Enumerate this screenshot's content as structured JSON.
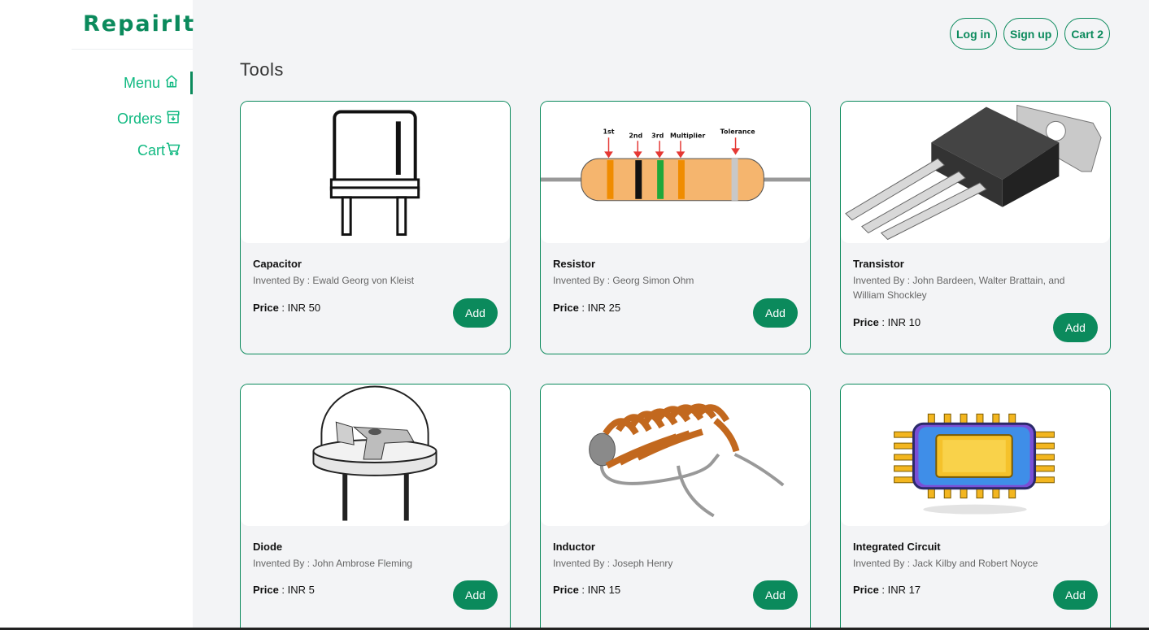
{
  "brand": "RepairIt",
  "nav": [
    {
      "label": "Menu",
      "icon": "home-icon"
    },
    {
      "label": "Orders",
      "icon": "archive-icon"
    },
    {
      "label": "Cart",
      "icon": "cart-icon"
    }
  ],
  "header": {
    "login": "Log in",
    "signup": "Sign up",
    "cart": "Cart 2"
  },
  "section_title": "Tools",
  "products": [
    {
      "name": "Capacitor",
      "inventor": "Invented By : Ewald Georg von Kleist",
      "price_label": "Price",
      "price_value": " : INR 50",
      "add": "Add"
    },
    {
      "name": "Resistor",
      "inventor": "Invented By : Georg Simon Ohm",
      "price_label": "Price",
      "price_value": " : INR 25",
      "add": "Add"
    },
    {
      "name": "Transistor",
      "inventor": "Invented By : John Bardeen, Walter Brattain, and William Shockley",
      "price_label": "Price",
      "price_value": " : INR 10",
      "add": "Add"
    },
    {
      "name": "Diode",
      "inventor": "Invented By : John Ambrose Fleming",
      "price_label": "Price",
      "price_value": " : INR 5",
      "add": "Add"
    },
    {
      "name": "Inductor",
      "inventor": "Invented By : Joseph Henry",
      "price_label": "Price",
      "price_value": " : INR 15",
      "add": "Add"
    },
    {
      "name": "Integrated Circuit",
      "inventor": "Invented By : Jack Kilby and Robert Noyce",
      "price_label": "Price",
      "price_value": " : INR 17",
      "add": "Add"
    }
  ],
  "resistor_labels": {
    "first": "1st",
    "second": "2nd",
    "third": "3rd",
    "multiplier": "Multiplier",
    "tolerance": "Tolerance"
  },
  "colors": {
    "accent": "#0b8a5c",
    "nav_text": "#10b981",
    "page_bg": "#f3f4f6"
  }
}
